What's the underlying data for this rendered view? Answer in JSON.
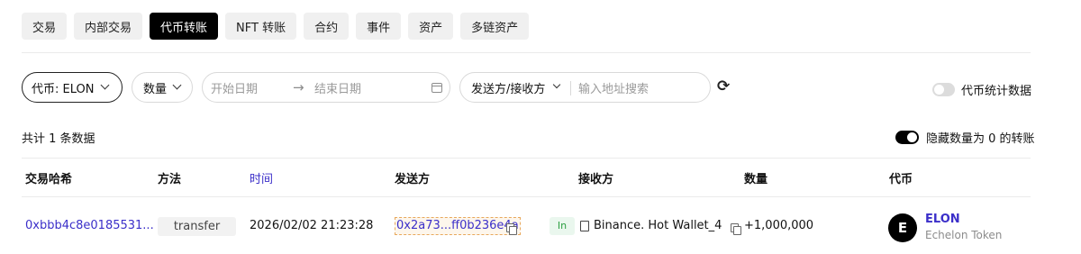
{
  "tabs": [
    {
      "label": "交易",
      "active": false
    },
    {
      "label": "内部交易",
      "active": false
    },
    {
      "label": "代币转账",
      "active": true
    },
    {
      "label": "NFT 转账",
      "active": false
    },
    {
      "label": "合约",
      "active": false
    },
    {
      "label": "事件",
      "active": false
    },
    {
      "label": "资产",
      "active": false
    },
    {
      "label": "多链资产",
      "active": false
    }
  ],
  "filters": {
    "token_label": "代币: ELON",
    "quantity_label": "数量",
    "start_date_placeholder": "开始日期",
    "end_date_placeholder": "结束日期",
    "direction_label": "发送方/接收方",
    "address_placeholder": "输入地址搜索",
    "stats_toggle_label": "代币统计数据",
    "stats_toggle_on": false
  },
  "summary": {
    "count_text": "共计 1 条数据",
    "hide_zero_label": "隐藏数量为 0 的转账",
    "hide_zero_on": true
  },
  "table": {
    "columns": [
      "交易哈希",
      "方法",
      "时间",
      "发送方",
      "接收方",
      "数量",
      "代币"
    ],
    "rows": [
      {
        "hash": "0xbbb4c8e0185531...",
        "method": "transfer",
        "time": "2026/02/02 21:23:28",
        "from": "0x2a73...ff0b236e4a",
        "direction": "In",
        "to": "Binance. Hot Wallet_4",
        "amount": "+1,000,000",
        "token_symbol": "ELON",
        "token_name": "Echelon Token",
        "token_avatar": "E"
      }
    ]
  },
  "colors": {
    "accent": "#3b2fc9",
    "in_badge_text": "#2ea043",
    "in_badge_bg": "#eaf7ee"
  }
}
